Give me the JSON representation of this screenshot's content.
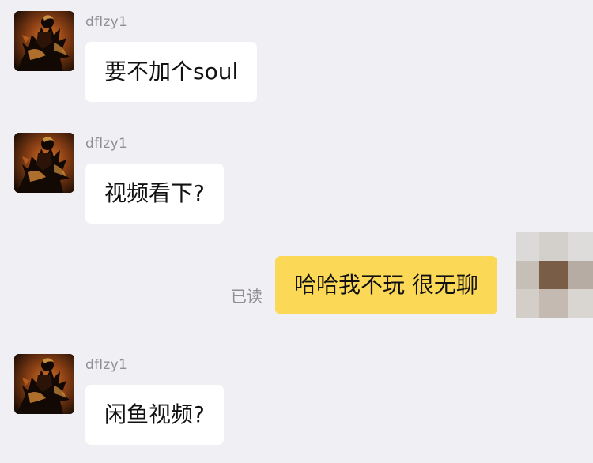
{
  "messages": [
    {
      "sender": "dflzy1",
      "text": "要不加个soul",
      "avatar": "shadow-warrior-avatar"
    },
    {
      "sender": "dflzy1",
      "text": "视频看下?",
      "avatar": "shadow-warrior-avatar"
    },
    {
      "sender": "self",
      "text": "哈哈我不玩 很无聊",
      "status": "已读",
      "avatar": "pixelated-avatar"
    },
    {
      "sender": "dflzy1",
      "text": "闲鱼视频?",
      "avatar": "shadow-warrior-avatar"
    }
  ],
  "colors": {
    "background": "#efeff4",
    "incoming_bubble": "#ffffff",
    "outgoing_bubble": "#fbd957",
    "meta_text": "#8e8e93"
  }
}
